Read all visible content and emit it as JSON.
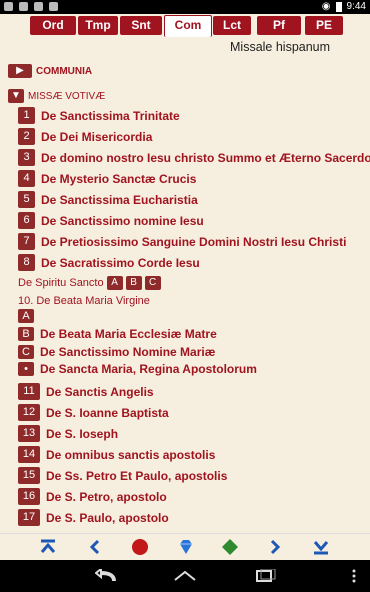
{
  "status": {
    "time": "9:44"
  },
  "tabs": [
    "Ord",
    "Tmp",
    "Snt",
    "Com",
    "Lct",
    "Pf",
    "PE"
  ],
  "active_tab": "Com",
  "header_title": "Missale hispanum",
  "sections": {
    "communia": "COMMUNIA",
    "votive": "MISSÆ VOTIVÆ"
  },
  "items": [
    {
      "num": "1",
      "label": "De Sanctissima Trinitate"
    },
    {
      "num": "2",
      "label": "De Dei Misericordia"
    },
    {
      "num": "3",
      "label": "De domino nostro Iesu christo Summo et Æterno Sacerdote"
    },
    {
      "num": "4",
      "label": "De Mysterio Sanctæ Crucis"
    },
    {
      "num": "5",
      "label": "De Sanctissima Eucharistia"
    },
    {
      "num": "6",
      "label": "De Sanctissimo nomine Iesu"
    },
    {
      "num": "7",
      "label": "De Pretiosissimo Sanguine Domini Nostri Iesu Christi"
    },
    {
      "num": "8",
      "label": "De Sacratissimo Corde Iesu"
    }
  ],
  "spiritu": {
    "label": "De Spiritu Sancto",
    "options": [
      "A",
      "B",
      "C"
    ]
  },
  "maria": {
    "title": "10. De Beata Maria Virgine"
  },
  "maria_items": [
    {
      "num": "A",
      "label": ""
    },
    {
      "num": "B",
      "label": "De Beata Maria Ecclesiæ Matre"
    },
    {
      "num": "C",
      "label": "De Sanctissimo Nomine Mariæ"
    },
    {
      "num": "•",
      "label": "De Sancta Maria, Regina Apostolorum"
    }
  ],
  "items2": [
    {
      "num": "11",
      "label": "De Sanctis Angelis"
    },
    {
      "num": "12",
      "label": "De S. Ioanne Baptista"
    },
    {
      "num": "13",
      "label": "De S. Ioseph"
    },
    {
      "num": "14",
      "label": "De omnibus sanctis apostolis"
    },
    {
      "num": "15",
      "label": "De Ss. Petro Et Paulo, apostolis"
    },
    {
      "num": "16",
      "label": "De S. Petro, apostolo"
    },
    {
      "num": "17",
      "label": "De S. Paulo, apostolo"
    }
  ],
  "nav": [
    {
      "icon": "first-page-icon"
    },
    {
      "icon": "previous-icon"
    },
    {
      "icon": "red-circle-icon"
    },
    {
      "icon": "blue-gem-icon"
    },
    {
      "icon": "green-diamond-icon"
    },
    {
      "icon": "next-icon"
    },
    {
      "icon": "last-page-icon"
    }
  ]
}
